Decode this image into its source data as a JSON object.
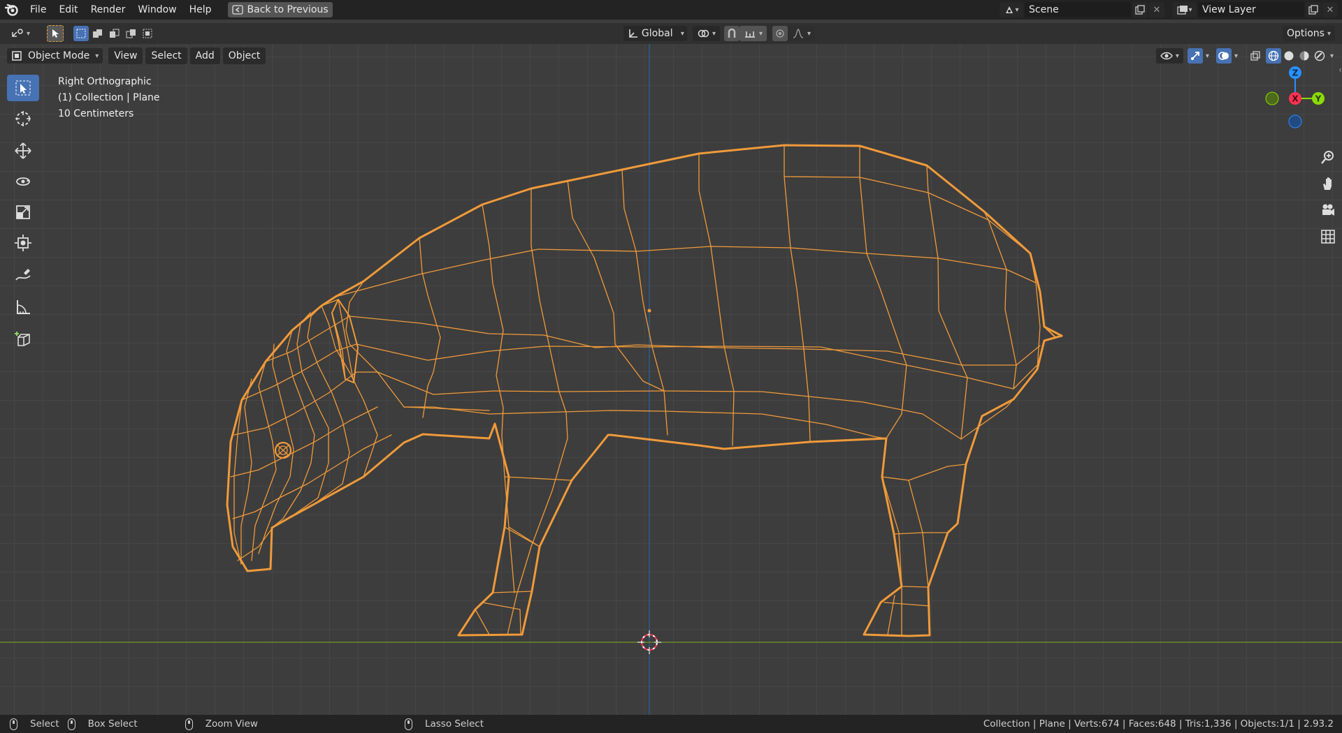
{
  "topbar": {
    "menus": [
      "File",
      "Edit",
      "Render",
      "Window",
      "Help"
    ],
    "back_button": "Back to Previous",
    "scene_name": "Scene",
    "view_layer": "View Layer"
  },
  "header": {
    "transform_orientation": "Global",
    "options_label": "Options"
  },
  "viewport_header": {
    "mode": "Object Mode",
    "menus": [
      "View",
      "Select",
      "Add",
      "Object"
    ]
  },
  "overlay_info": {
    "view_name": "Right Orthographic",
    "collection": "(1) Collection | Plane",
    "scale": "10 Centimeters"
  },
  "gizmo": {
    "z": "Z",
    "x": "X",
    "y": "Y"
  },
  "colors": {
    "wireframe": "#f09a3a",
    "axis_x": "#ff3352",
    "axis_y": "#8bdc00",
    "axis_z": "#2890ff",
    "accent": "#4772b3"
  },
  "statusbar": {
    "select": "Select",
    "box_select": "Box Select",
    "zoom_view": "Zoom View",
    "lasso_select": "Lasso Select",
    "stats": "Collection | Plane | Verts:674 | Faces:648 | Tris:1,336 | Objects:1/1 | 2.93.2"
  }
}
